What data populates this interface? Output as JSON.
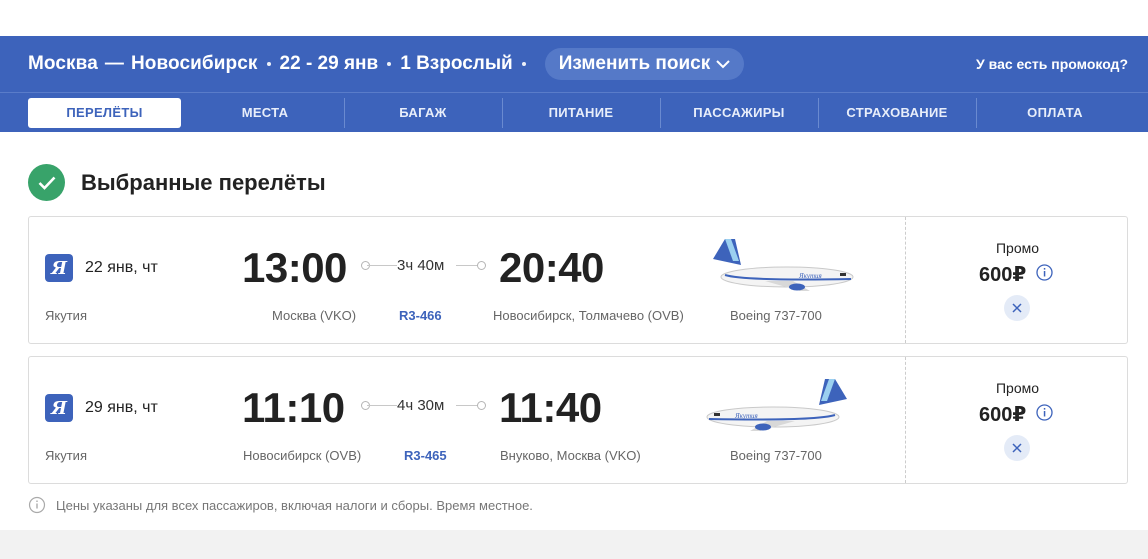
{
  "header": {
    "route_from": "Москва",
    "route_dash": "—",
    "route_to": "Новосибирск",
    "dates": "22 - 29 янв",
    "passengers": "1 Взрослый",
    "change_search": "Изменить поиск",
    "promo_question": "У вас есть промокод?",
    "bg_color": "#3d63bb"
  },
  "tabs": [
    {
      "label": "ПЕРЕЛЁТЫ",
      "active": true
    },
    {
      "label": "МЕСТА"
    },
    {
      "label": "БАГАЖ"
    },
    {
      "label": "ПИТАНИЕ"
    },
    {
      "label": "ПАССАЖИРЫ"
    },
    {
      "label": "СТРАХОВАНИЕ"
    },
    {
      "label": "ОПЛАТА"
    }
  ],
  "selected": {
    "title": "Выбранные перелёты",
    "check_color": "#38a36a"
  },
  "flights": [
    {
      "airline_logo": "Я",
      "date": "22 янв, чт",
      "airline": "Якутия",
      "dep_time": "13:00",
      "arr_time": "20:40",
      "duration": "3ч 40м",
      "from": "Москва (VKO)",
      "flight_no": "R3-466",
      "to": "Новосибирск, Толмачево (OVB)",
      "aircraft": "Boeing 737-700",
      "fare": "Промо",
      "price": "600₽"
    },
    {
      "airline_logo": "Я",
      "date": "29 янв, чт",
      "airline": "Якутия",
      "dep_time": "11:10",
      "arr_time": "11:40",
      "duration": "4ч 30м",
      "from": "Новосибирск (OVB)",
      "flight_no": "R3-465",
      "to": "Внуково, Москва (VKO)",
      "aircraft": "Boeing 737-700",
      "fare": "Промо",
      "price": "600₽"
    }
  ],
  "note": "Цены указаны для всех пассажиров, включая налоги и сборы. Время местное."
}
